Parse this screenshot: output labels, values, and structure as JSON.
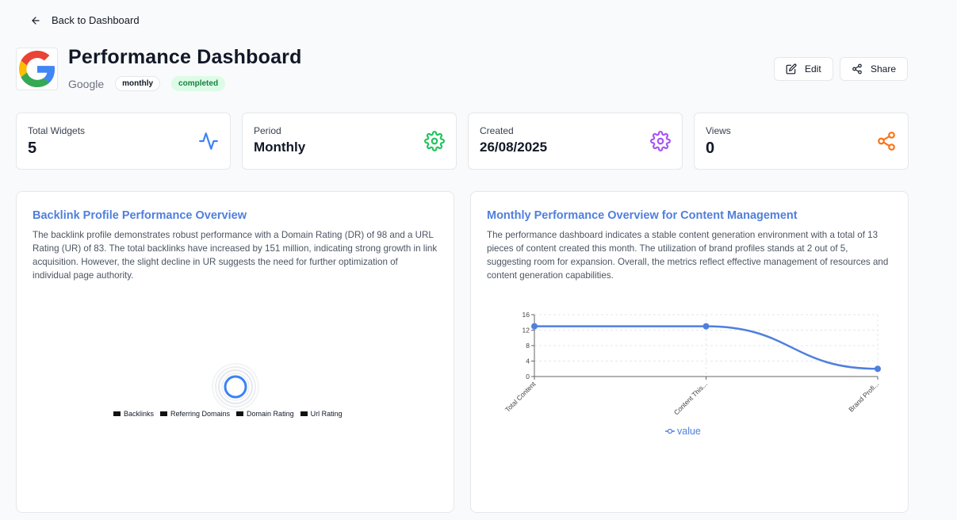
{
  "nav": {
    "back_label": "Back to Dashboard"
  },
  "header": {
    "title": "Performance Dashboard",
    "brand": "Google",
    "frequency": "monthly",
    "status": "completed",
    "edit_label": "Edit",
    "share_label": "Share"
  },
  "stats": [
    {
      "label": "Total Widgets",
      "value": "5",
      "icon": "activity-icon",
      "color": "#3b82f6"
    },
    {
      "label": "Period",
      "value": "Monthly",
      "icon": "gear-icon",
      "color": "#22c55e"
    },
    {
      "label": "Created",
      "value": "26/08/2025",
      "icon": "gear-icon",
      "color": "#a855f7"
    },
    {
      "label": "Views",
      "value": "0",
      "icon": "share-icon",
      "color": "#f97316"
    }
  ],
  "widgets": [
    {
      "title": "Backlink Profile Performance Overview",
      "description": "The backlink profile demonstrates robust performance with a Domain Rating (DR) of 98 and a URL Rating (UR) of 83. The total backlinks have increased by 151 million, indicating strong growth in link acquisition. However, the slight decline in UR suggests the need for further optimization of individual page authority.",
      "legend": [
        "Backlinks",
        "Referring Domains",
        "Domain Rating",
        "Url Rating"
      ]
    },
    {
      "title": "Monthly Performance Overview for Content Management",
      "description": "The performance dashboard indicates a stable content generation environment with a total of 13 pieces of content created this month. The utilization of brand profiles stands at 2 out of 5, suggesting room for expansion. Overall, the metrics reflect effective management of resources and content generation capabilities."
    }
  ],
  "chart_data": {
    "type": "line",
    "categories": [
      "Total Content",
      "Content This...",
      "Brand Profi..."
    ],
    "series": [
      {
        "name": "value",
        "values": [
          13,
          13,
          2
        ]
      }
    ],
    "ylim": [
      0,
      16
    ],
    "yticks": [
      0,
      4,
      8,
      12,
      16
    ],
    "grid": true,
    "legend": "bottom",
    "color": "#4f7fdd"
  }
}
